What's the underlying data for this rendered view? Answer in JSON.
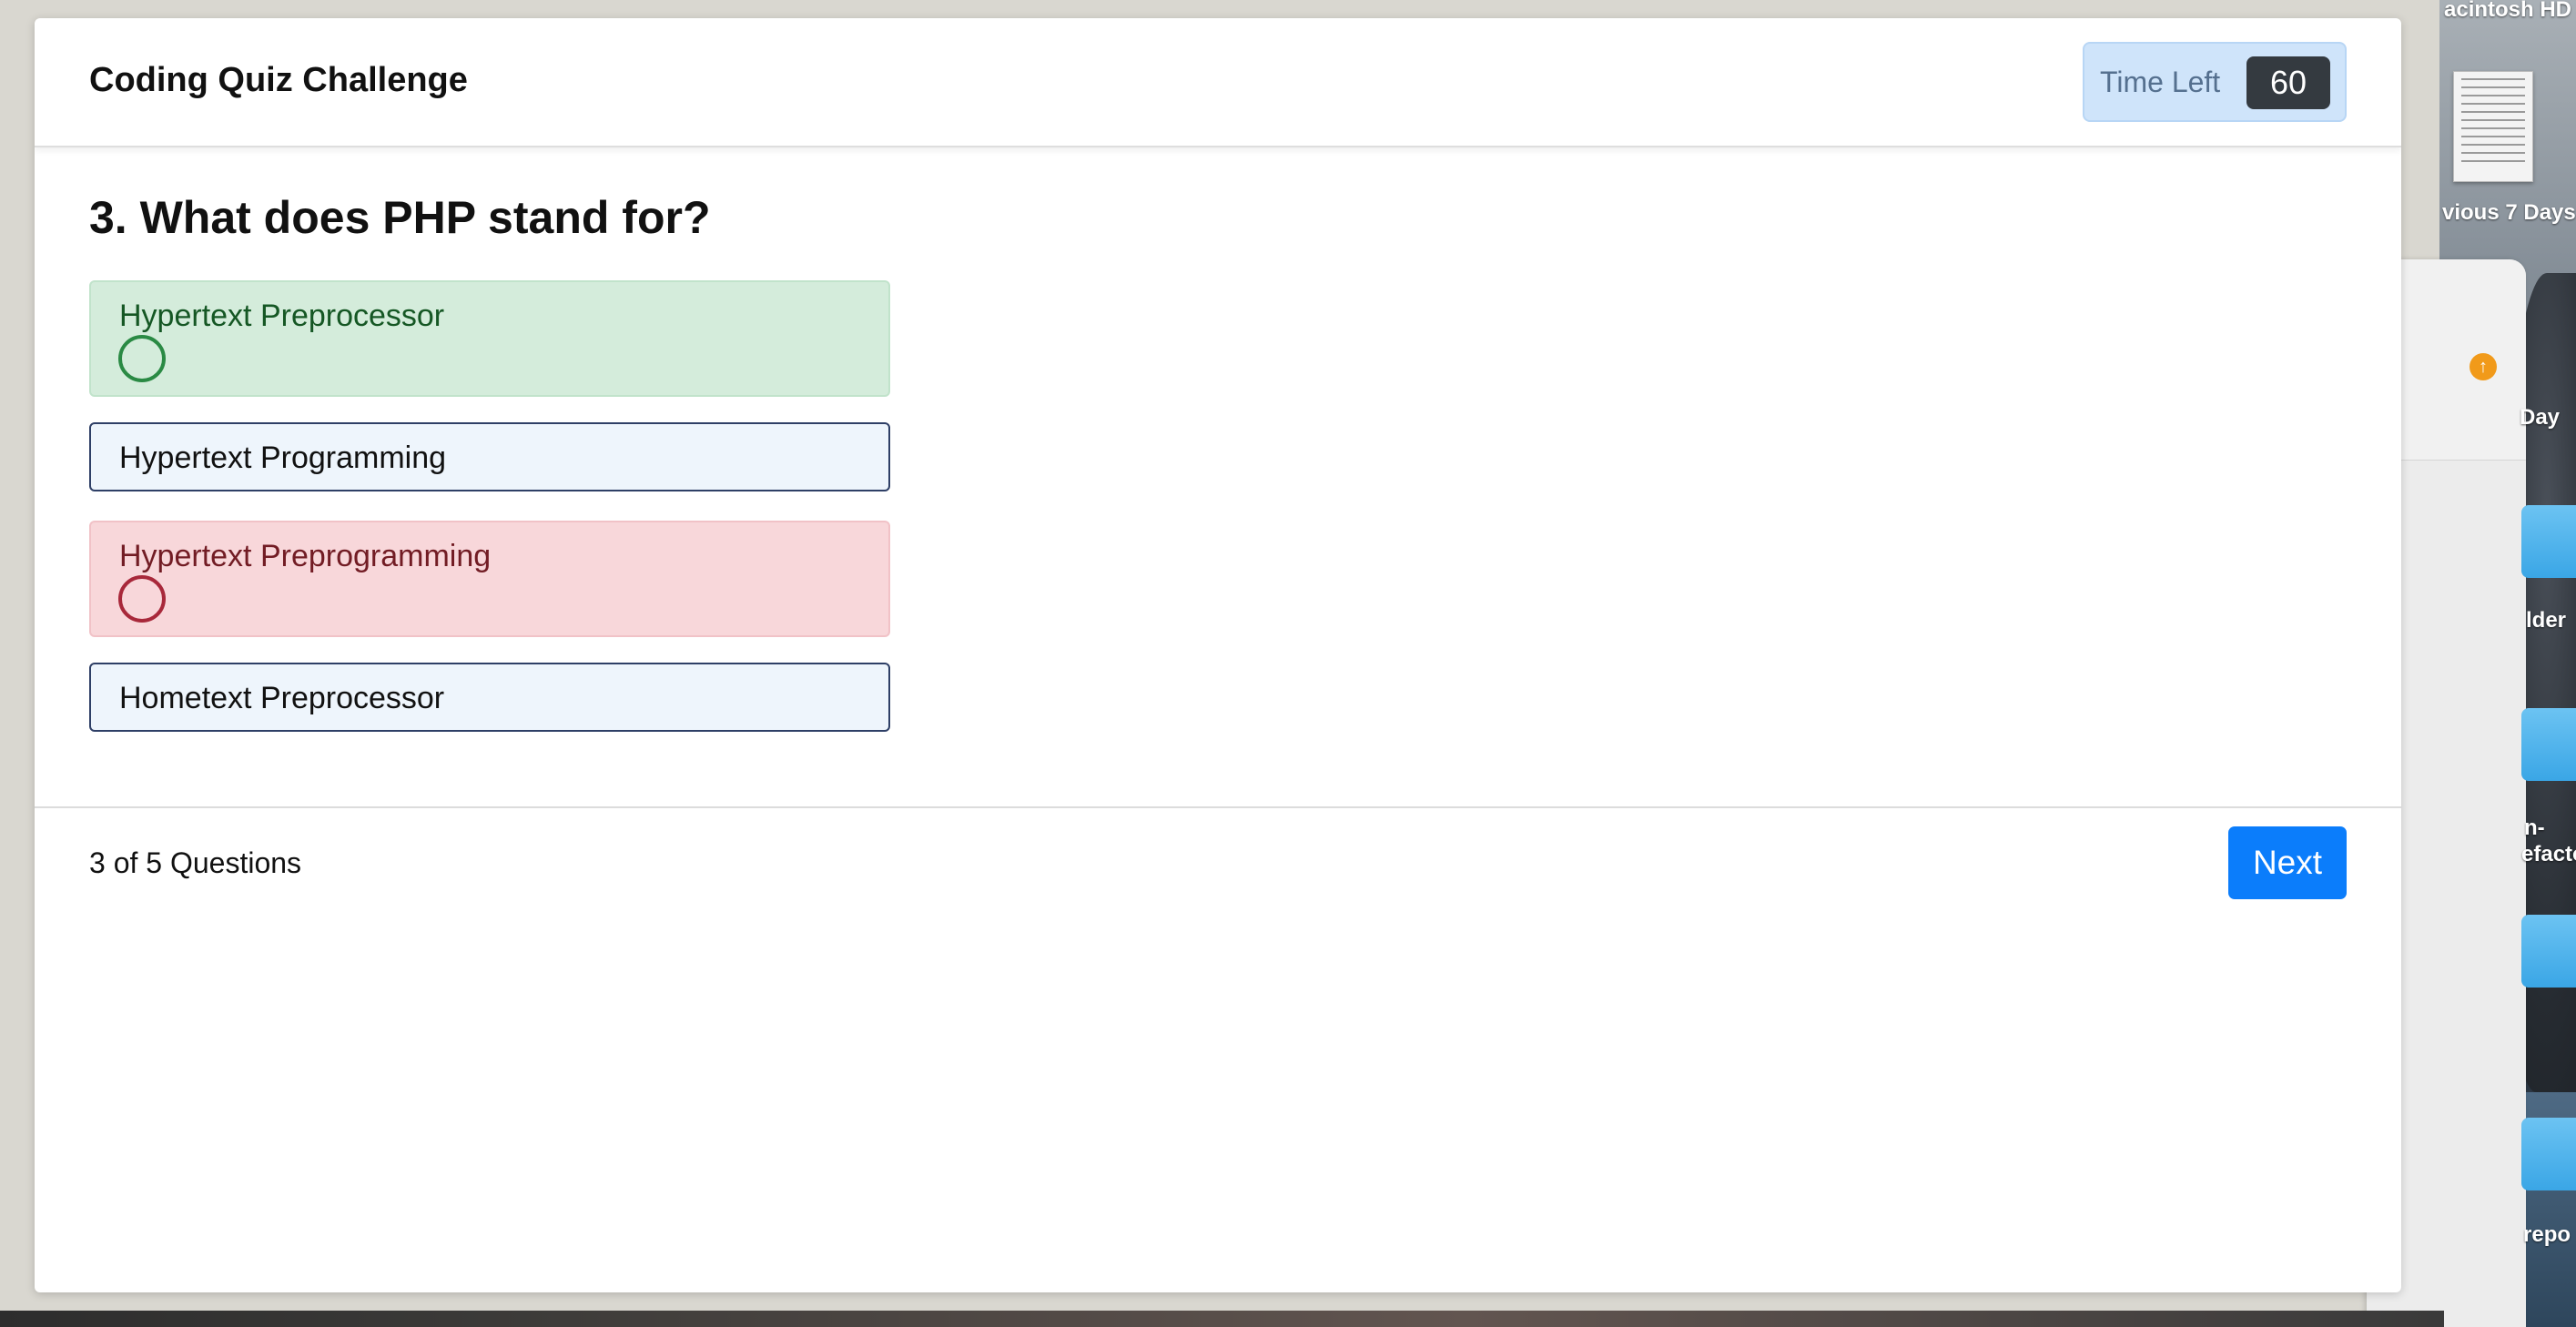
{
  "app": {
    "title": "Coding Quiz Challenge",
    "timer_label": "Time Left",
    "timer_value": "60"
  },
  "question": {
    "text": "3. What does PHP stand for?",
    "options": [
      {
        "label": "Hypertext Preprocessor",
        "state": "correct"
      },
      {
        "label": "Hypertext Programming",
        "state": "neutral"
      },
      {
        "label": "Hypertext Preprogramming",
        "state": "incorrect"
      },
      {
        "label": "Hometext Preprocessor",
        "state": "neutral"
      }
    ]
  },
  "footer": {
    "progress": "3 of 5 Questions",
    "next_label": "Next"
  },
  "desktop": {
    "drive_label": "acintosh HD",
    "recents_label": "vious 7 Days",
    "finder_label": "Day",
    "folder1_label": "lder",
    "folder2_label_a": "n-",
    "folder2_label_b": "efacto",
    "folder3_label": "repo"
  },
  "colors": {
    "correct_bg": "#d4ecdb",
    "incorrect_bg": "#f8d7da",
    "neutral_bg": "#eef5fc",
    "primary": "#0b7dfb",
    "timer_bg": "#cfe4fa"
  }
}
